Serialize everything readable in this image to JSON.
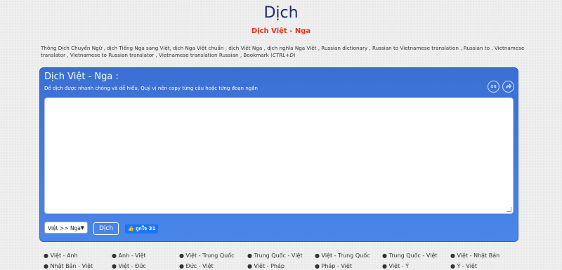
{
  "header": {
    "title": "Dịch",
    "subtitle": "Dịch Việt - Nga"
  },
  "keywords": {
    "text": "Thông Dịch Chuyển Ngữ , dịch Tiếng Nga sang Việt, dịch Nga Việt chuẩn , dịch Việt Nga , dịch nghĩa Nga Việt , Russian dictionary , Russian to Vietnamese translation , Russian to , Vietnamese translator , Vietnamese to Russian translator , Vietnamese translation Russian , Bookmark (",
    "shortcut": "CTRL+D",
    "close": ")"
  },
  "translator": {
    "title": "Dịch Việt - Nga :",
    "description": "Để dịch được nhanh chóng và dễ hiểu, Quý vị nên copy từng câu hoặc từng đoạn ngắn",
    "input_value": "",
    "direction_selected": "Việt >> Nga",
    "translate_label": "Dịch",
    "like_label": "ถูกใจ 31",
    "accent_color": "#3b6fd3",
    "icon_aa": "aa",
    "icon_share": "share-icon"
  },
  "language_links": [
    "Việt - Anh",
    "Anh - Việt",
    "Việt - Trung Quốc",
    "Trung Quốc - Việt",
    "Việt - Trung Quốc",
    "Trung Quốc - Việt",
    "Việt - Nhật Bản",
    "Nhật Bản - Việt",
    "Việt - Đức",
    "Đức - Việt",
    "Việt - Pháp",
    "Pháp - Việt",
    "Việt - Ý",
    "Ý - Việt"
  ]
}
